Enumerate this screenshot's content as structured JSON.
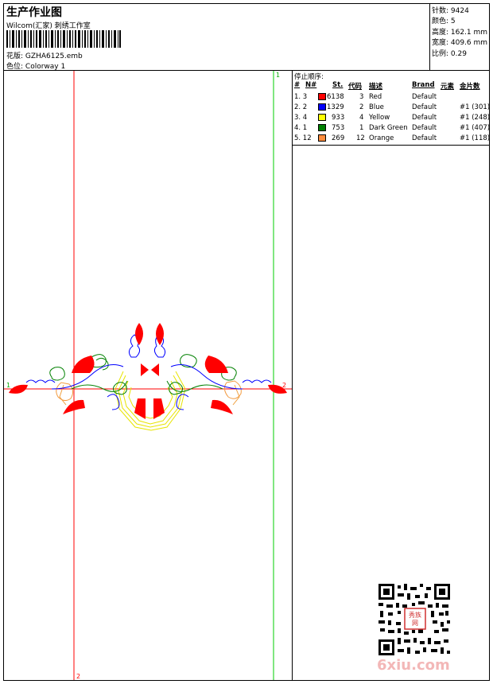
{
  "header": {
    "title": "生产作业图",
    "company": "Wilcom(汇家) 刺绣工作室",
    "design_label": "花版:",
    "design_value": "GZHA6125.emb",
    "colorway_label": "色位:",
    "colorway_value": "Colorway 1"
  },
  "stats": {
    "stitches": "针数: 9424",
    "colors": "颜色: 5",
    "height": "高度: 162.1 mm",
    "width": "宽度: 409.6 mm",
    "ratio": "比例: 0.29"
  },
  "table": {
    "label": "停止顺序:",
    "headers": [
      "#",
      "N#",
      "St.",
      "代码",
      "描述",
      "Brand",
      "元素",
      "金片数"
    ],
    "rows": [
      {
        "idx": "1. 3",
        "color": "#ff0000",
        "stitches": "6138",
        "code": "3",
        "desc": "Red",
        "brand": "Default",
        "seq": ""
      },
      {
        "idx": "2. 2",
        "color": "#0000ff",
        "stitches": "1329",
        "code": "2",
        "desc": "Blue",
        "brand": "Default",
        "seq": "#1 (301)"
      },
      {
        "idx": "3. 4",
        "color": "#ffff00",
        "stitches": "933",
        "code": "4",
        "desc": "Yellow",
        "brand": "Default",
        "seq": "#1 (248)"
      },
      {
        "idx": "4. 1",
        "color": "#008000",
        "stitches": "753",
        "code": "1",
        "desc": "Dark Green",
        "brand": "Default",
        "seq": "#1 (407)"
      },
      {
        "idx": "5. 12",
        "color": "#ff8c3c",
        "stitches": "269",
        "code": "12",
        "desc": "Orange",
        "brand": "Default",
        "seq": "#1 (118)"
      }
    ]
  },
  "guides": {
    "v_red_bottom": "2",
    "v_green_top": "1",
    "h_left": "1",
    "h_right": "2"
  },
  "watermark": "6xiu.com",
  "stamp": "秀族网"
}
